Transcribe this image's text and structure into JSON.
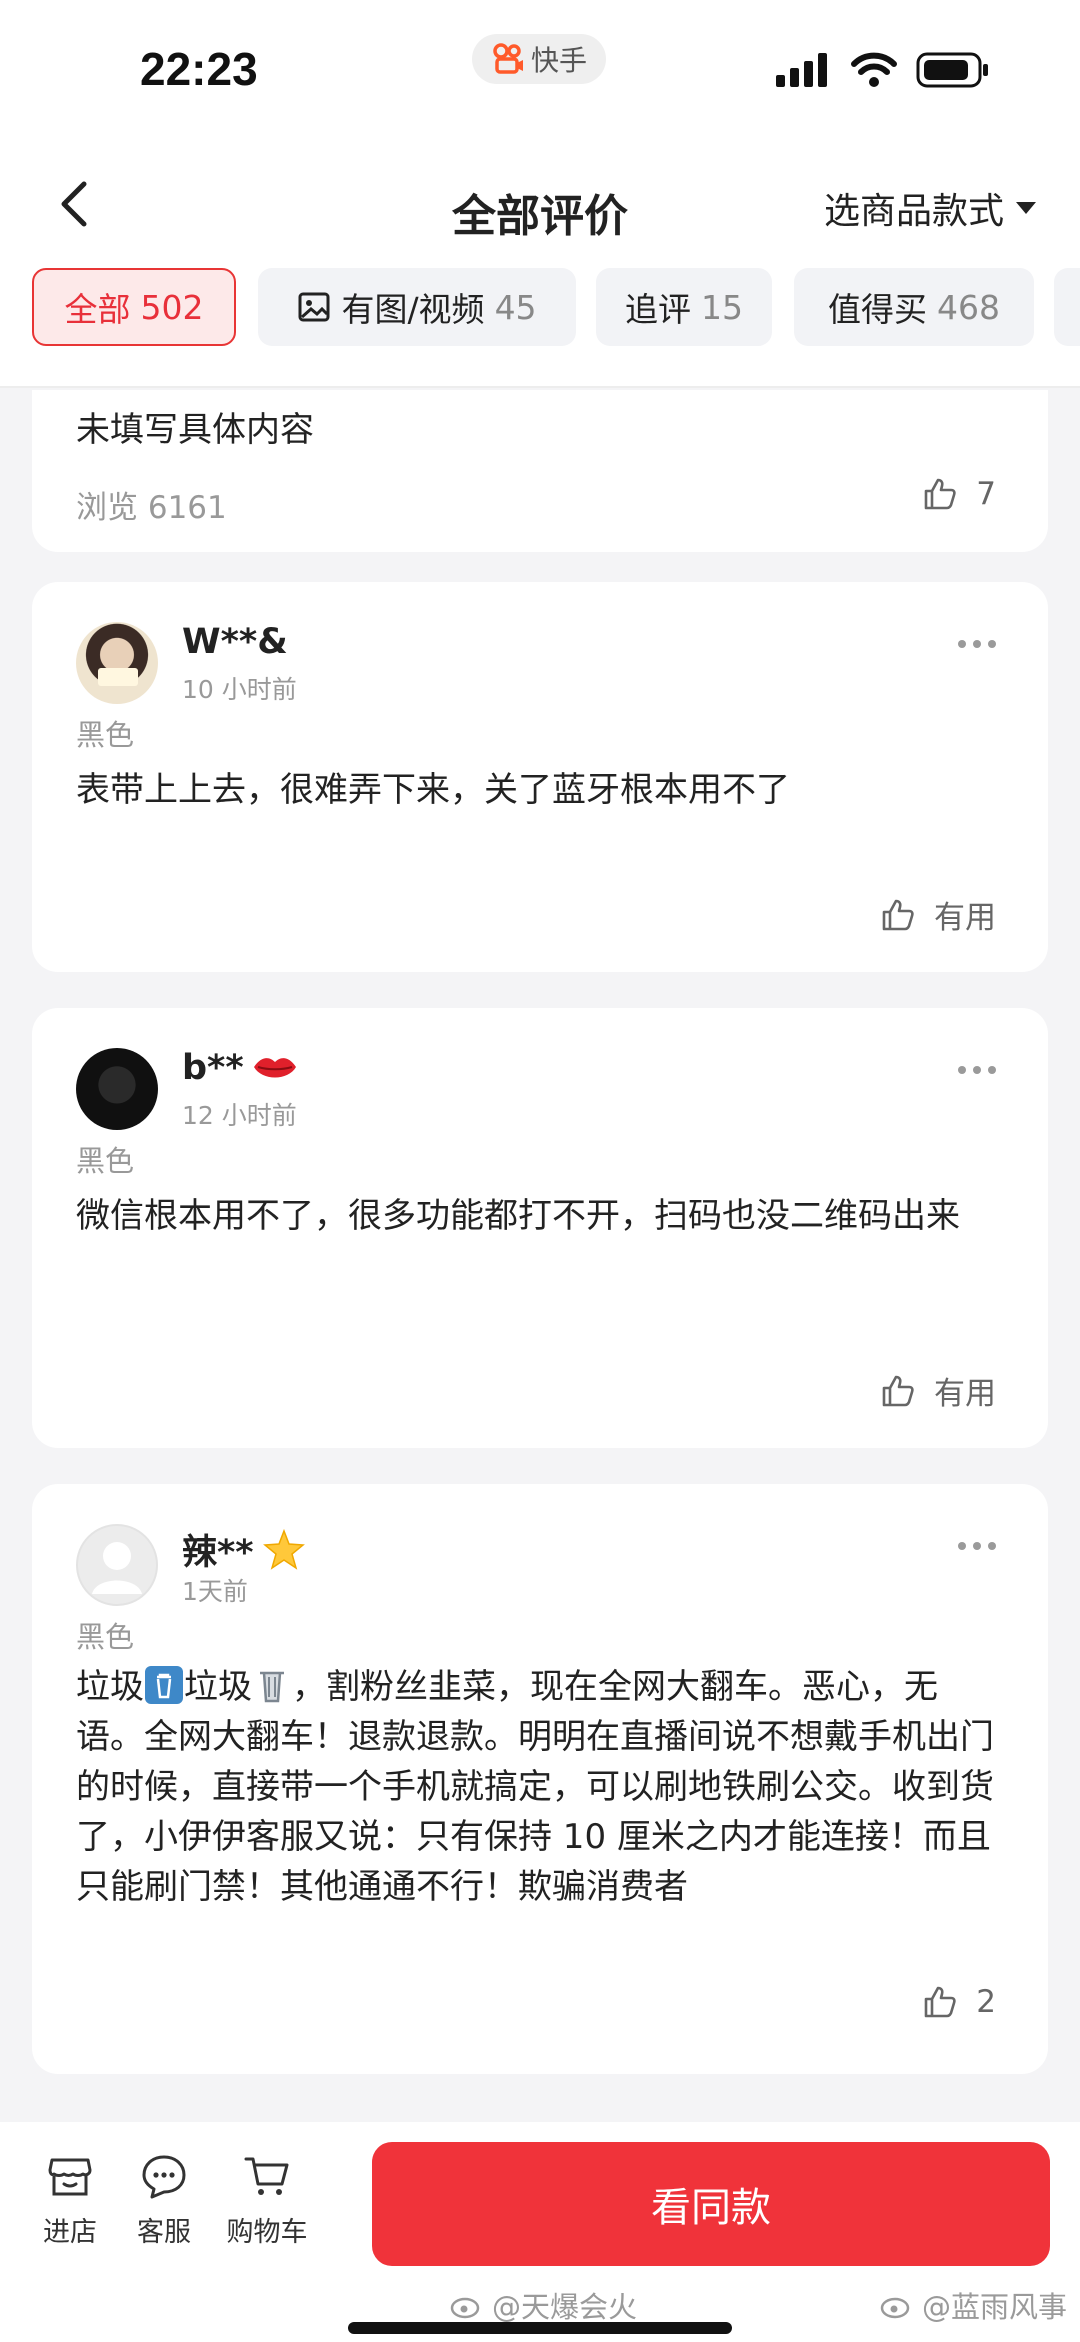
{
  "status_bar": {
    "time": "22:23",
    "app_name": "快手"
  },
  "nav": {
    "title": "全部评价",
    "style_select": "选商品款式"
  },
  "filters": [
    {
      "label": "全部",
      "count": "502"
    },
    {
      "label": "有图/视频",
      "count": "45"
    },
    {
      "label": "追评",
      "count": "15"
    },
    {
      "label": "值得买",
      "count": "468"
    }
  ],
  "reviews": [
    {
      "text": "未填写具体内容",
      "views": "浏览 6161",
      "likes": "7"
    },
    {
      "name": "W**&",
      "time": "10 小时前",
      "variant": "黑色",
      "text": "表带上上去，很难弄下来，关了蓝牙根本用不了",
      "likes": "有用"
    },
    {
      "name": "b**",
      "time": "12 小时前",
      "variant": "黑色",
      "text": "微信根本用不了，很多功能都打不开，扫码也没二维码出来",
      "likes": "有用"
    },
    {
      "name": "辣**",
      "time": "1天前",
      "variant": "黑色",
      "text_parts": [
        "垃圾",
        "垃圾",
        "，割粉丝韭菜，现在全网大翻车。恶心，无语。全网大翻车！退款退款。明明在直播间说不想戴手机出门的时候，直接带一个手机就搞定，可以刷地铁刷公交。收到货了，小伊伊客服又说：只有保持 10 厘米之内才能连接！而且只能刷门禁！其他通通不行！欺骗消费者"
      ],
      "likes": "2"
    }
  ],
  "bottom_bar": {
    "tabs": [
      {
        "label": "进店"
      },
      {
        "label": "客服"
      },
      {
        "label": "购物车"
      }
    ],
    "buy_label": "看同款"
  },
  "watermarks": [
    "@天爆会火",
    "@蓝雨风事"
  ],
  "colors": {
    "accent": "#f0333a",
    "active_chip_bg": "#fde9e9",
    "page_bg": "#f4f4f6"
  }
}
